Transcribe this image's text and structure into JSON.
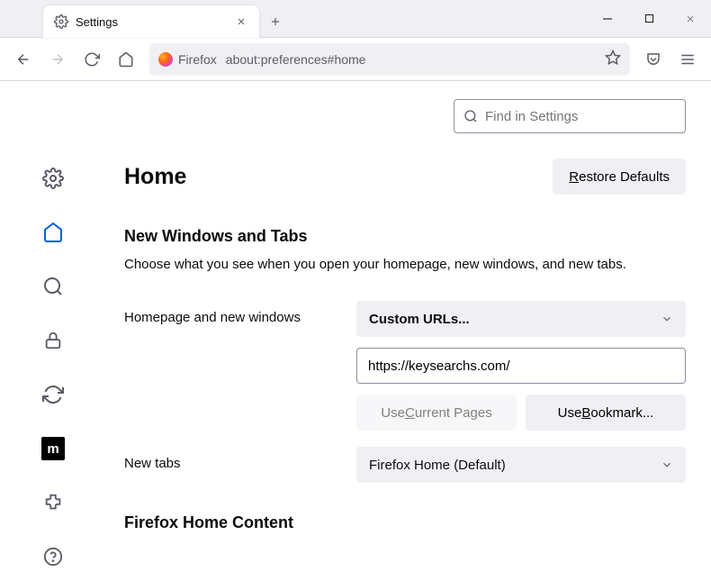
{
  "tab": {
    "title": "Settings"
  },
  "urlbar": {
    "brand": "Firefox",
    "url": "about:preferences#home"
  },
  "search": {
    "placeholder": "Find in Settings"
  },
  "page": {
    "title": "Home",
    "restore_defaults": "Restore Defaults",
    "section1_title": "New Windows and Tabs",
    "section1_desc": "Choose what you see when you open your homepage, new windows, and new tabs.",
    "homepage_label": "Homepage and new windows",
    "homepage_select": "Custom URLs...",
    "homepage_url": "https://keysearchs.com/",
    "use_current": "Use Current Pages",
    "use_bookmark": "Use Bookmark...",
    "newtabs_label": "New tabs",
    "newtabs_select": "Firefox Home (Default)",
    "home_content_title": "Firefox Home Content"
  },
  "moz": "m"
}
